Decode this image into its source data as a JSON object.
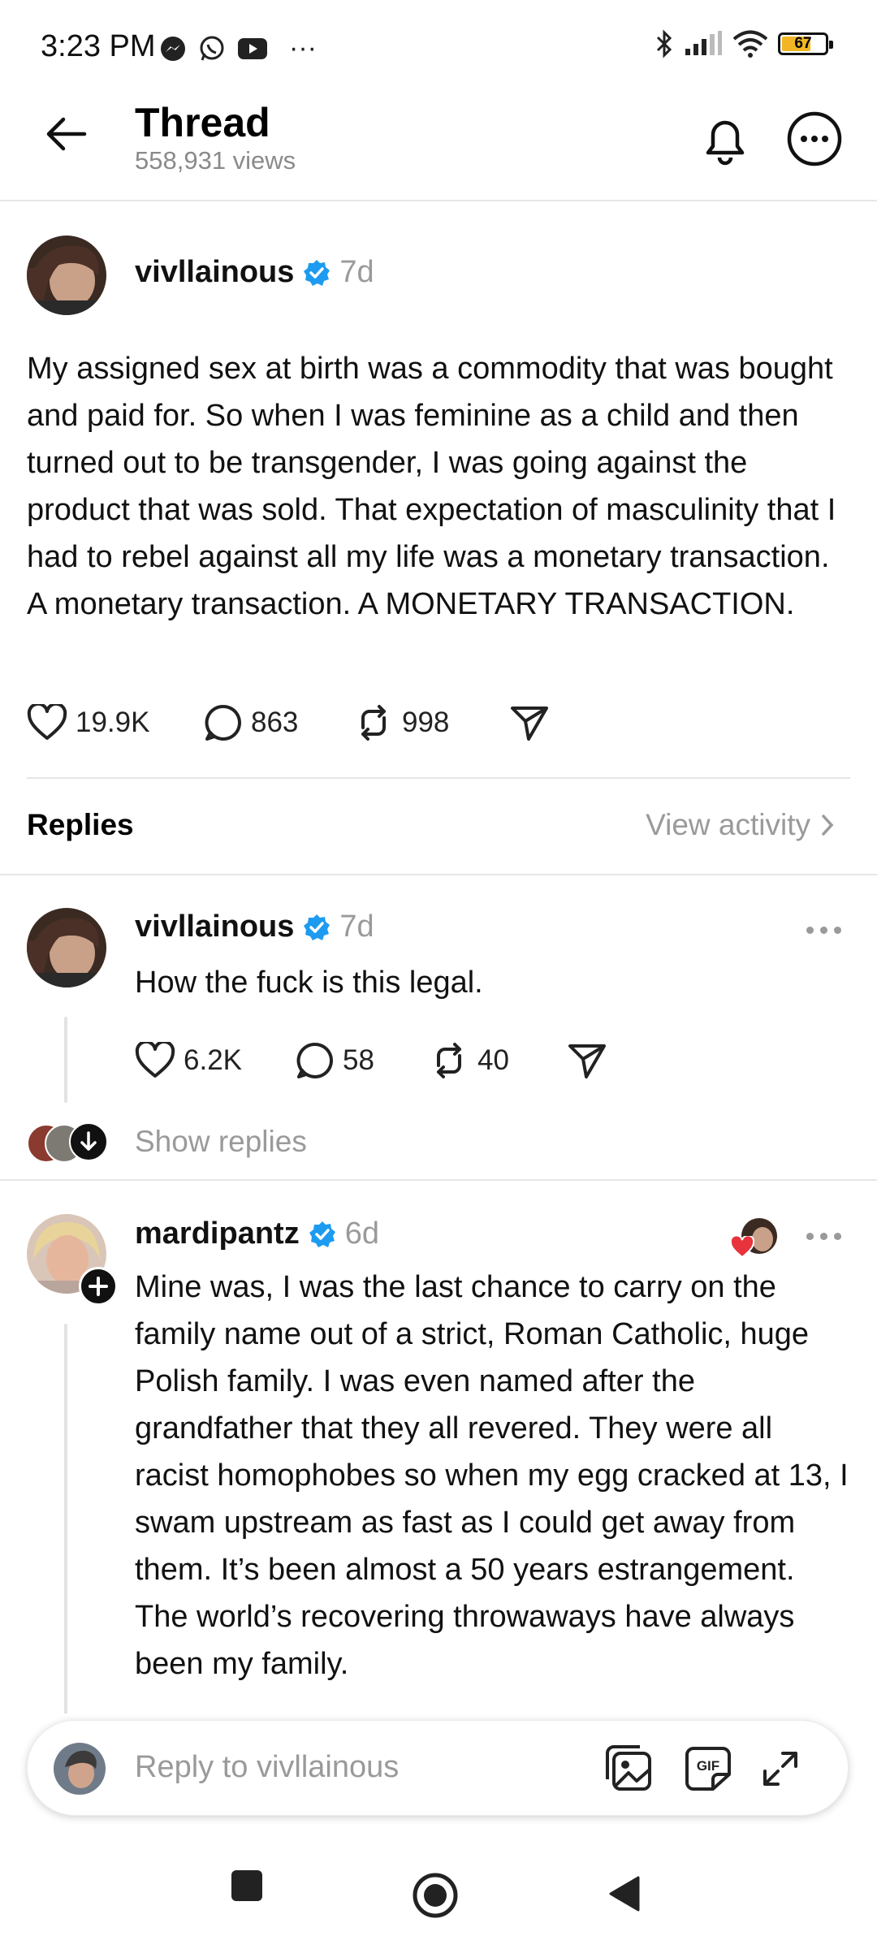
{
  "status_bar": {
    "time": "3:23 PM",
    "left_icons": [
      "messenger-icon",
      "whatsapp-icon",
      "youtube-icon",
      "more-icon"
    ],
    "overflow": "···",
    "right_icons": [
      "bluetooth-icon",
      "signal-icon",
      "wifi-icon"
    ],
    "battery": "67"
  },
  "header": {
    "title": "Thread",
    "views": "558,931 views"
  },
  "post": {
    "username": "vivllainous",
    "time": "7d",
    "text": "My assigned sex at birth was a commodity that was bought and paid for. So when I was feminine as a child and then turned out to be transgender, I was going against the product that was sold. That expectation of masculinity that I had to rebel against all my life was a monetary transaction. A monetary transaction. A MONETARY TRANSACTION.",
    "likes": "19.9K",
    "comments": "863",
    "reposts": "998"
  },
  "replies_section": {
    "label": "Replies",
    "view_activity": "View activity"
  },
  "replies": [
    {
      "username": "vivllainous",
      "time": "7d",
      "text": "How the fuck is this legal.",
      "likes": "6.2K",
      "comments": "58",
      "reposts": "40",
      "show_replies": "Show replies"
    },
    {
      "username": "mardipantz",
      "time": "6d",
      "text": "Mine was, I was the last chance to carry on the family name out of a strict, Roman Catholic, huge Polish family. I was even named after the grandfather that they all revered. They were all racist homophobes so when my egg cracked at 13, I swam upstream as fast as I could get away from them. It’s been almost a 50 years estrangement.\nThe world’s recovering throwaways have always been my family."
    }
  ],
  "composer": {
    "placeholder": "Reply to vivllainous"
  },
  "colors": {
    "verified": "#1d9bf0",
    "muted": "#9a9a9a",
    "battery_fill": "#f2b624",
    "heart": "#e8323c"
  }
}
